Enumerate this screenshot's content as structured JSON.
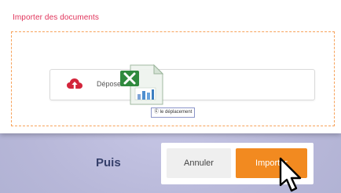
{
  "dialog": {
    "title": "Importer des documents"
  },
  "dropzone": {
    "label": "Déposer",
    "drag_tooltip": "Ⓔ le déplacement"
  },
  "instruction": {
    "then_label": "Puis"
  },
  "actions": {
    "cancel_label": "Annuler",
    "import_label": "Importer"
  },
  "icons": {
    "upload": "cloud-upload-icon",
    "dragged_file": "spreadsheet-file-icon",
    "cursor": "mouse-cursor-icon"
  },
  "colors": {
    "title": "#e0335a",
    "dropzone_border": "#f7a25a",
    "upload_icon": "#d3253b",
    "import_button": "#f28a20",
    "cancel_button": "#efefef",
    "puis_text": "#36406b",
    "background": "#b7b7d8"
  }
}
